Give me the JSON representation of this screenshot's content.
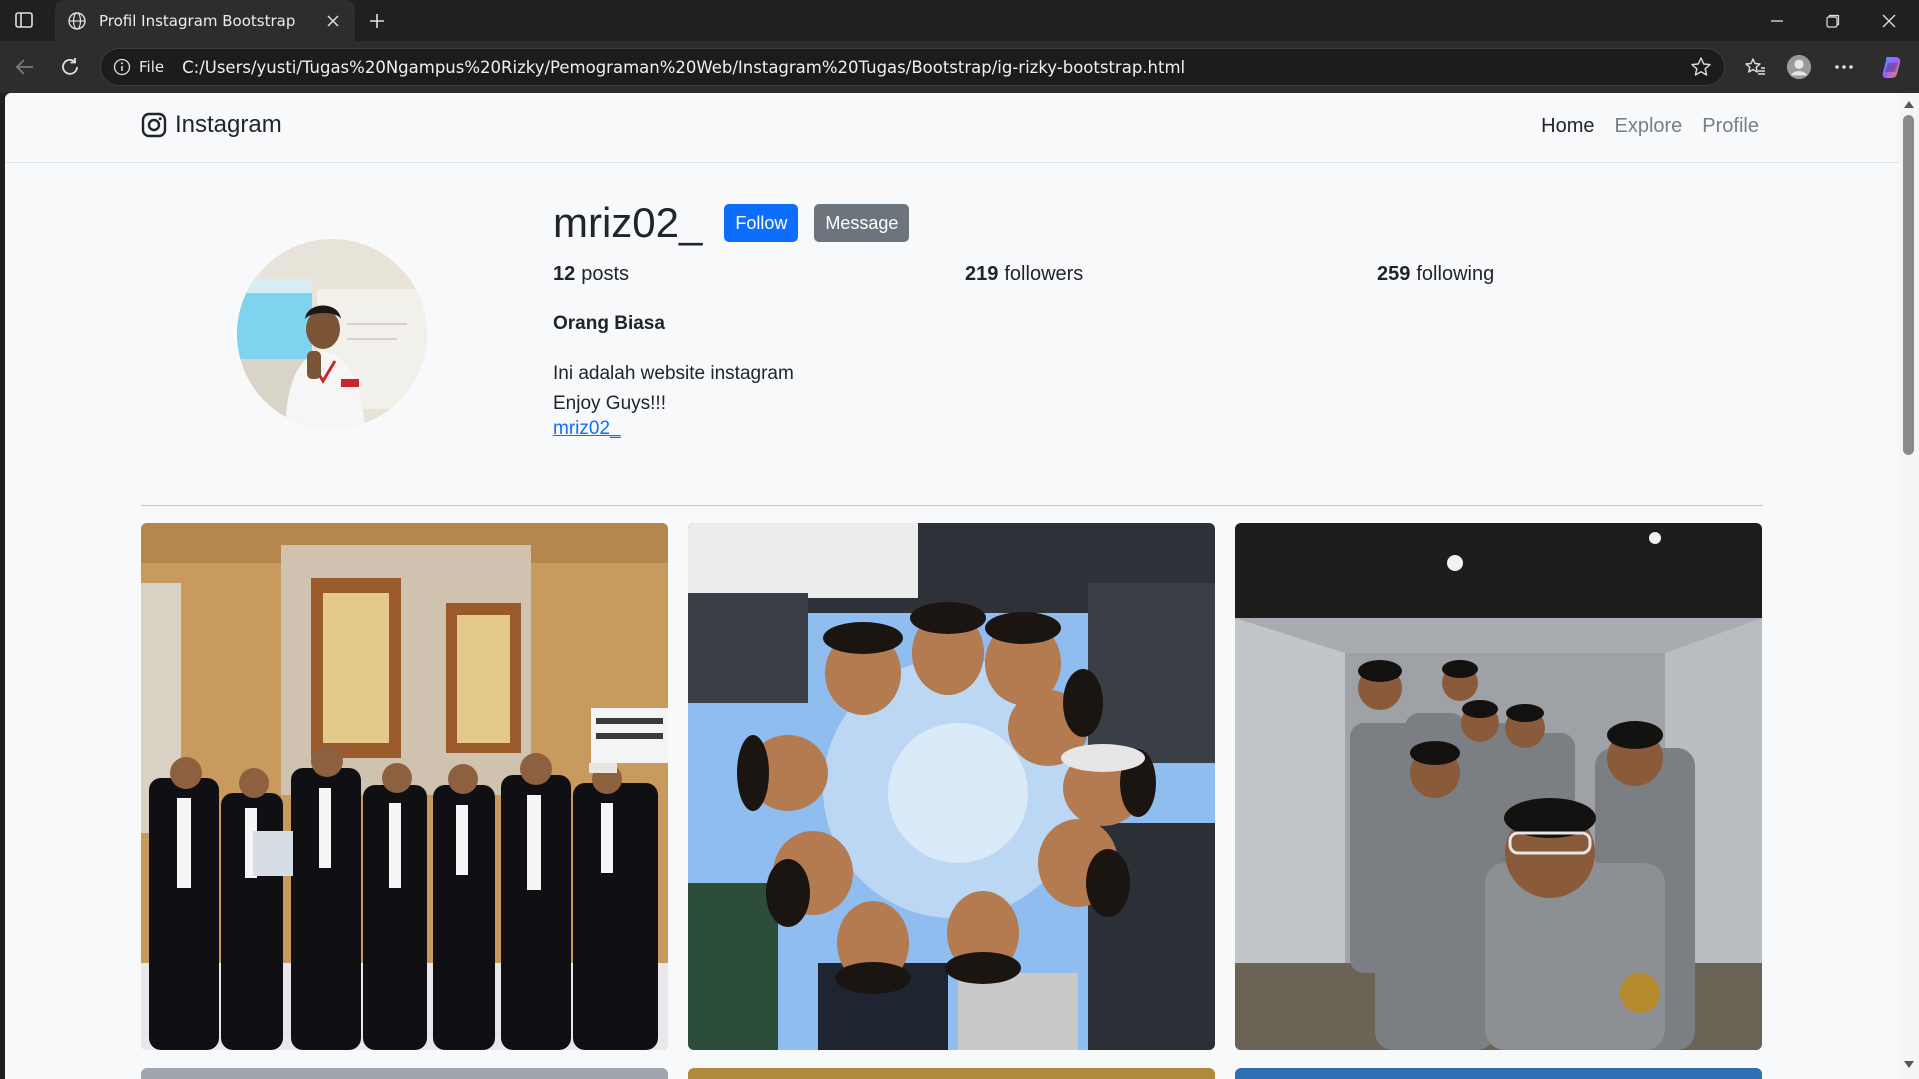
{
  "browser": {
    "tab_title": "Profil Instagram Bootstrap",
    "address_scheme": "File",
    "address_url": "C:/Users/yusti/Tugas%20Ngampus%20Rizky/Pemograman%20Web/Instagram%20Tugas/Bootstrap/ig-rizky-bootstrap.html"
  },
  "navbar": {
    "brand": "Instagram",
    "links": [
      "Home",
      "Explore",
      "Profile"
    ]
  },
  "profile": {
    "username": "mriz02_",
    "follow_label": "Follow",
    "message_label": "Message",
    "posts_count": "12",
    "posts_label": "posts",
    "followers_count": "219",
    "followers_label": "followers",
    "following_count": "259",
    "following_label": "following",
    "bio_name": "Orang Biasa",
    "bio_line1": "Ini adalah website instagram",
    "bio_line2": "Enjoy Guys!!!",
    "bio_link": "mriz02_"
  },
  "colors": {
    "primary": "#0d6efd",
    "secondary": "#6c757d",
    "page_bg": "#f8f9fa"
  },
  "icons": [
    "sidebar-toggle-icon",
    "globe-icon",
    "close-icon",
    "plus-icon",
    "minimize-icon",
    "restore-icon",
    "back-icon",
    "refresh-icon",
    "info-icon",
    "star-icon",
    "favorites-icon",
    "profile-icon",
    "more-icon",
    "copilot-icon",
    "instagram-logo-icon"
  ]
}
